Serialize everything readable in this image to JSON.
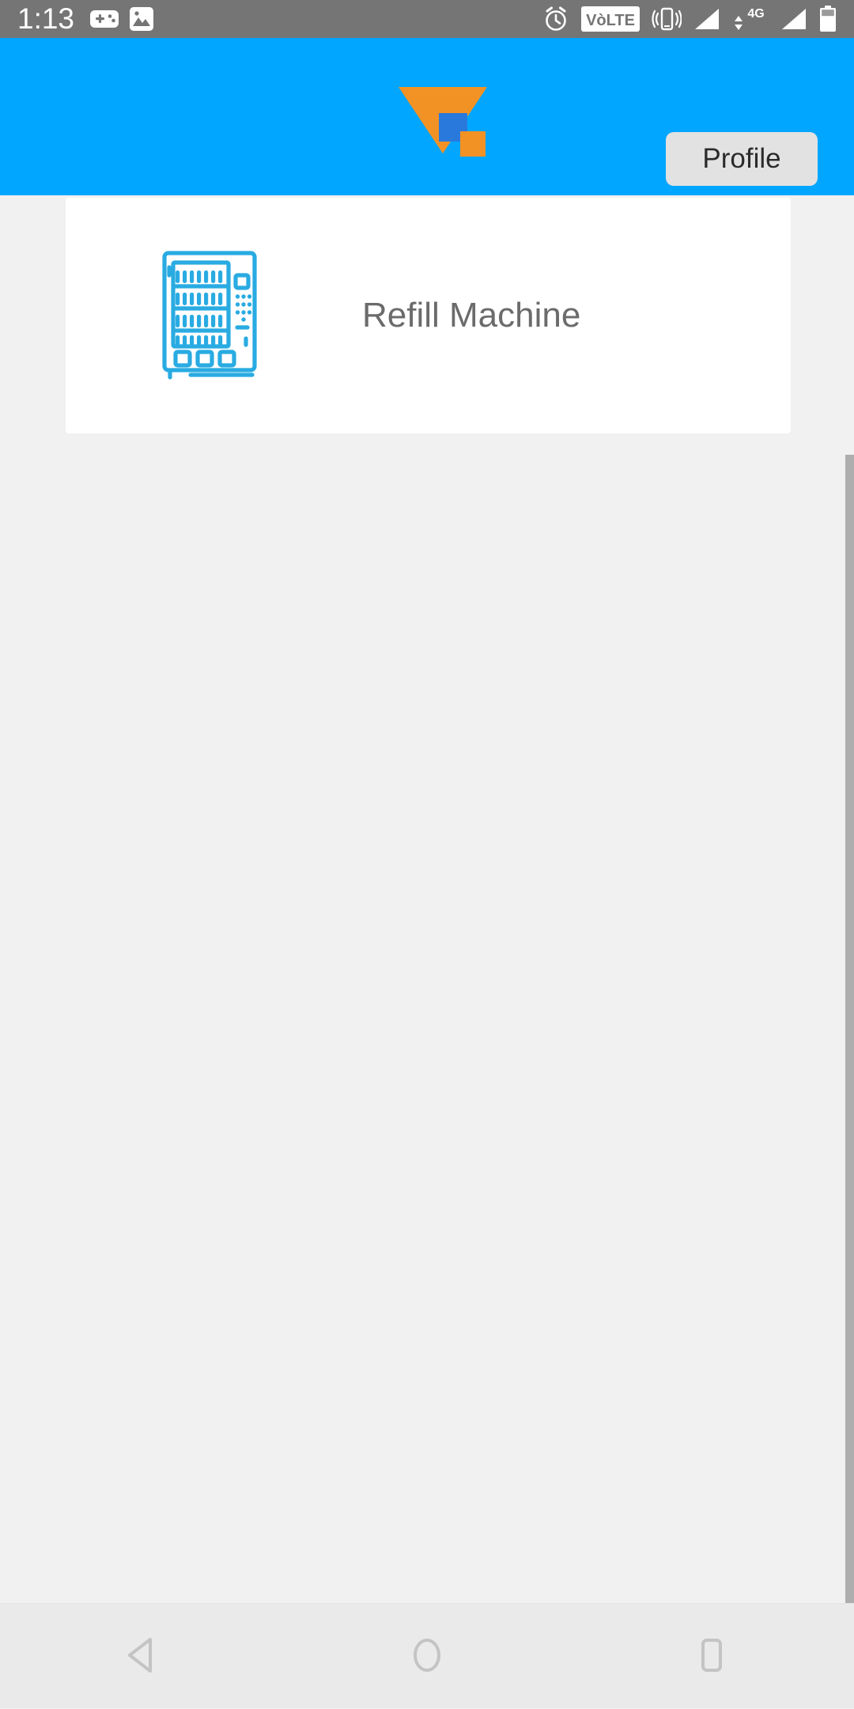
{
  "status_bar": {
    "time": "1:13",
    "left_icons": [
      "gamepad-icon",
      "image-icon"
    ],
    "right_icons": [
      "alarm-icon",
      "volte-icon",
      "vibrate-icon",
      "signal-icon",
      "data-4g-icon",
      "signal2-icon",
      "battery-icon"
    ],
    "volte_label": "VòLTE",
    "network_label": "4G",
    "background_color": "#757575"
  },
  "header": {
    "logo_name": "app-logo",
    "logo_colors": {
      "triangle": "#F39224",
      "square_blue": "#2979DD",
      "square_orange": "#F39224"
    },
    "profile_label": "Profile",
    "background_color": "#00A6FF"
  },
  "main": {
    "background_color": "#F1F1F1",
    "cards": [
      {
        "icon": "vending-machine-icon",
        "icon_color": "#29ABE2",
        "label": "Refill Machine"
      }
    ],
    "scrollbar": {
      "name": "vertical-scrollbar",
      "color": "#AEAEAE"
    }
  },
  "nav_bar": {
    "background_color": "#EAEAEA",
    "buttons": [
      {
        "name": "nav-back-button",
        "icon": "back-triangle-icon"
      },
      {
        "name": "nav-home-button",
        "icon": "home-circle-icon"
      },
      {
        "name": "nav-recents-button",
        "icon": "recents-square-icon"
      }
    ]
  }
}
